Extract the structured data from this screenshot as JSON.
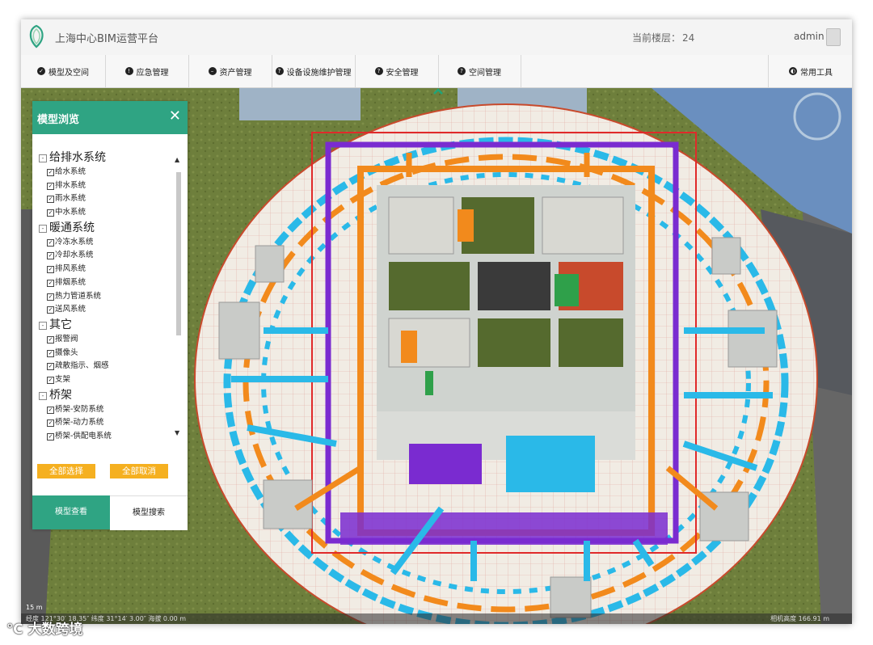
{
  "app": {
    "title": "上海中心BIM运营平台",
    "floor_label": "当前楼层：",
    "floor_value": "24",
    "user": "admin"
  },
  "nav": {
    "tabs": [
      {
        "label": "模型及空间",
        "icon": "check-circle-icon"
      },
      {
        "label": "应急管理",
        "icon": "alert-circle-icon"
      },
      {
        "label": "资产管理",
        "icon": "minus-circle-icon"
      },
      {
        "label": "设备设施维护管理",
        "icon": "question-circle-icon"
      },
      {
        "label": "安全管理",
        "icon": "question-circle-icon"
      },
      {
        "label": "空间管理",
        "icon": "question-circle-icon"
      }
    ],
    "tools": "常用工具"
  },
  "panel": {
    "title": "模型浏览",
    "groups": [
      {
        "name": "给排水系统",
        "items": [
          "给水系统",
          "排水系统",
          "雨水系统",
          "中水系统"
        ]
      },
      {
        "name": "暖通系统",
        "items": [
          "冷冻水系统",
          "冷却水系统",
          "排风系统",
          "排烟系统",
          "热力管道系统",
          "送风系统"
        ]
      },
      {
        "name": "其它",
        "items": [
          "报警阀",
          "摄像头",
          "疏散指示、烟感",
          "支架"
        ]
      },
      {
        "name": "桥架",
        "items": [
          "桥架-安防系统",
          "桥架-动力系统",
          "桥架-供配电系统"
        ]
      }
    ],
    "select_all": "全部选择",
    "deselect_all": "全部取消",
    "tab_view": "模型查看",
    "tab_search": "模型搜索"
  },
  "status": {
    "scale": "15 m",
    "left": "经度 121°30′ 18.35″  纬度 31°14′ 3.00″  海拔 0.00 m",
    "right": "相机高度 166.91 m"
  },
  "watermark": "大数跨境",
  "colors": {
    "accent": "#2fa483",
    "button": "#f5b020",
    "duct_blue": "#2ab9e8",
    "duct_orange": "#f28a1c",
    "pipe_purple": "#7a2bd0",
    "pipe_red": "#e02a2a"
  }
}
